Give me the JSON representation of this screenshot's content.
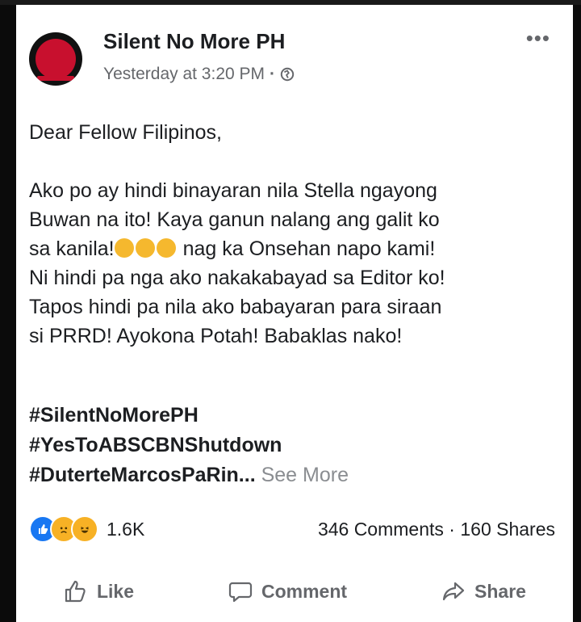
{
  "post": {
    "page_name": "Silent No More PH",
    "timestamp": "Yesterday at 3:20 PM",
    "separator": "·",
    "privacy_icon": "globe-icon",
    "more_label": "•••",
    "greeting": "Dear Fellow Filipinos,",
    "body_lines": [
      "Ako po ay hindi binayaran nila Stella ngayong",
      "Buwan na ito! Kaya ganun nalang ang galit ko",
      "sa kanila!",
      " nag ka Onsehan napo kami!",
      "Ni hindi pa nga ako nakakabayad sa Editor ko!",
      "Tapos hindi pa nila ako babayaran para siraan",
      "si PRRD! Ayokona Potah! Babaklas nako!"
    ],
    "hashtags": [
      "#SilentNoMorePH",
      "#YesToABSCBNShutdown",
      "#DuterteMarcosPaRin..."
    ],
    "see_more": "See More"
  },
  "engagement": {
    "reaction_icons": [
      "like-reaction-icon",
      "sad-reaction-icon",
      "haha-reaction-icon"
    ],
    "reaction_count": "1.6K",
    "comments": "346 Comments",
    "shares": "160 Shares",
    "separator": "·"
  },
  "actions": {
    "like": "Like",
    "comment": "Comment",
    "share": "Share"
  },
  "colors": {
    "brand_red": "#c8102e",
    "text": "#1c1e21",
    "muted": "#65676b",
    "like_blue": "#1877f2"
  }
}
